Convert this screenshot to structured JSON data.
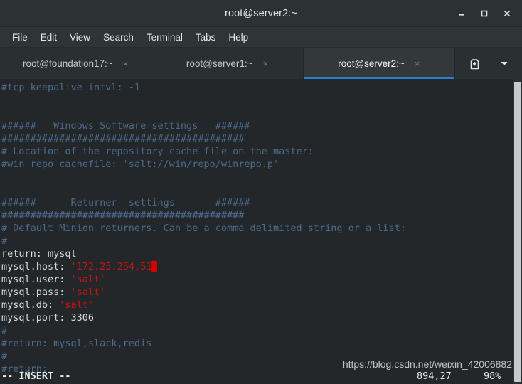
{
  "window": {
    "title": "root@server2:~",
    "buttons": {
      "minimize": "minimize",
      "maximize": "maximize",
      "close": "close"
    }
  },
  "menubar": {
    "items": [
      {
        "label": "File"
      },
      {
        "label": "Edit"
      },
      {
        "label": "View"
      },
      {
        "label": "Search"
      },
      {
        "label": "Terminal"
      },
      {
        "label": "Tabs"
      },
      {
        "label": "Help"
      }
    ]
  },
  "tabs": {
    "items": [
      {
        "label": "root@foundation17:~",
        "close": "×",
        "active": false
      },
      {
        "label": "root@server1:~",
        "close": "×",
        "active": false
      },
      {
        "label": "root@server2:~",
        "close": "×",
        "active": true
      }
    ],
    "new_tab_icon": "new-tab-icon",
    "dropdown_icon": "▾",
    "active_underline_color": "#2a7fd4"
  },
  "terminal": {
    "colors": {
      "background": "#242729",
      "foreground": "#d8dbdc",
      "comment": "#4a6b8d",
      "string": "#cc1111",
      "cursor": "#d40000"
    },
    "lines": [
      {
        "segments": [
          {
            "text": "#tcp_keepalive_intvl: -1",
            "style": "comment"
          }
        ]
      },
      {
        "segments": [
          {
            "text": "",
            "style": "text"
          }
        ]
      },
      {
        "segments": [
          {
            "text": "",
            "style": "text"
          }
        ]
      },
      {
        "segments": [
          {
            "text": "######   Windows Software settings   ######",
            "style": "comment"
          }
        ]
      },
      {
        "segments": [
          {
            "text": "##########################################",
            "style": "comment"
          }
        ]
      },
      {
        "segments": [
          {
            "text": "# Location of the repository cache file on the master:",
            "style": "comment"
          }
        ]
      },
      {
        "segments": [
          {
            "text": "#win_repo_cachefile: 'salt://win/repo/winrepo.p'",
            "style": "comment"
          }
        ]
      },
      {
        "segments": [
          {
            "text": "",
            "style": "text"
          }
        ]
      },
      {
        "segments": [
          {
            "text": "",
            "style": "text"
          }
        ]
      },
      {
        "segments": [
          {
            "text": "######      Returner  settings       ######",
            "style": "comment"
          }
        ]
      },
      {
        "segments": [
          {
            "text": "##########################################",
            "style": "comment"
          }
        ]
      },
      {
        "segments": [
          {
            "text": "# Default Minion returners. Can be a comma delimited string or a list:",
            "style": "comment"
          }
        ]
      },
      {
        "segments": [
          {
            "text": "#",
            "style": "comment"
          }
        ]
      },
      {
        "segments": [
          {
            "text": "return: mysql",
            "style": "text"
          }
        ]
      },
      {
        "segments": [
          {
            "text": "mysql.host: ",
            "style": "text"
          },
          {
            "text": "'172.25.254.51",
            "style": "string"
          },
          {
            "text": "'",
            "style": "cursor"
          }
        ]
      },
      {
        "segments": [
          {
            "text": "mysql.user: ",
            "style": "text"
          },
          {
            "text": "'salt'",
            "style": "string"
          }
        ]
      },
      {
        "segments": [
          {
            "text": "mysql.pass: ",
            "style": "text"
          },
          {
            "text": "'salt'",
            "style": "string"
          }
        ]
      },
      {
        "segments": [
          {
            "text": "mysql.db: ",
            "style": "text"
          },
          {
            "text": "'salt'",
            "style": "string"
          }
        ]
      },
      {
        "segments": [
          {
            "text": "mysql.port: 3306",
            "style": "text"
          }
        ]
      },
      {
        "segments": [
          {
            "text": "#",
            "style": "comment"
          }
        ]
      },
      {
        "segments": [
          {
            "text": "#return: mysql,slack,redis",
            "style": "comment"
          }
        ]
      },
      {
        "segments": [
          {
            "text": "#",
            "style": "comment"
          }
        ]
      },
      {
        "segments": [
          {
            "text": "#return:",
            "style": "comment"
          }
        ]
      }
    ],
    "status": {
      "mode": "-- INSERT --",
      "position": "894,27",
      "percent": "98%"
    }
  },
  "watermark": {
    "text": "https://blog.csdn.net/weixin_42006882"
  }
}
